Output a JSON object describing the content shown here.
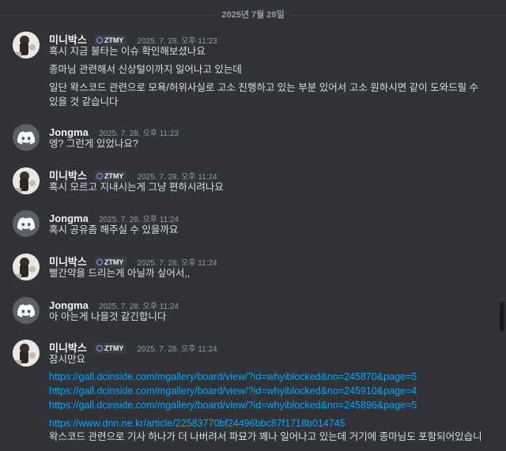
{
  "date_divider": "2025년 7월 28일",
  "colors": {
    "background": "#313338",
    "link": "#00a8fc",
    "tag_icon": "#a78bfa"
  },
  "messages": [
    {
      "author": "미니박스",
      "avatar": "photo",
      "tag": "ZTMY",
      "time": "2025. 7. 28. 오후 11:23",
      "lines": [
        "혹시 지금 불타는 이슈 확인해보셨나요",
        "종마님 관련해서 신상털이까지 일어나고 있는데",
        "일단 왁스코드 관련으로 모욕/허위사실로 고소 진행하고 있는 부분 있어서 고소 원하시면 같이 도와드릴 수",
        "있을 것 같습니다"
      ]
    },
    {
      "author": "Jongma",
      "avatar": "discord-icon",
      "time": "2025. 7. 28. 오후 11:23",
      "lines": [
        "엥? 그런게 있었나요?"
      ]
    },
    {
      "author": "미니박스",
      "avatar": "photo",
      "tag": "ZTMY",
      "time": "2025. 7. 28. 오후 11:24",
      "lines": [
        "혹시 모르고 지내시는게 그냥 편하시려나요"
      ]
    },
    {
      "author": "Jongma",
      "avatar": "discord-icon",
      "time": "2025. 7. 28. 오후 11:24",
      "lines": [
        "혹시 공유좀 해주실 수 있을까요"
      ]
    },
    {
      "author": "미니박스",
      "avatar": "photo",
      "tag": "ZTMY",
      "time": "2025. 7. 28. 오후 11:24",
      "lines": [
        "빨간약을 드리는게 아닐까 싶어서,,"
      ]
    },
    {
      "author": "Jongma",
      "avatar": "discord-icon",
      "time": "2025. 7. 28. 오후 11:24",
      "lines": [
        "아 아는게 나을것 같긴합니다"
      ]
    },
    {
      "author": "미니박스",
      "avatar": "photo",
      "tag": "ZTMY",
      "time": "2025. 7. 28. 오후 11:24",
      "lines": [
        "잠시만요"
      ],
      "links": [
        "https://gall.dcinside.com/mgallery/board/view/?id=whyiblocked&no=245870&page=5",
        "https://gall.dcinside.com/mgallery/board/view/?id=whyiblocked&no=245910&page=4",
        "https://gall.dcinside.com/mgallery/board/view/?id=whyiblocked&no=245896&page=5",
        "https://www.dnn.ne.kr/article/22583770bf24496bbc87f1718b014745"
      ],
      "trailing": "왁스코드 관련으로 기사 하나가 더 나버려서 파묘가 꽤나 일어나고 있는데 거기에 종마님도 포함되어있습니"
    }
  ]
}
